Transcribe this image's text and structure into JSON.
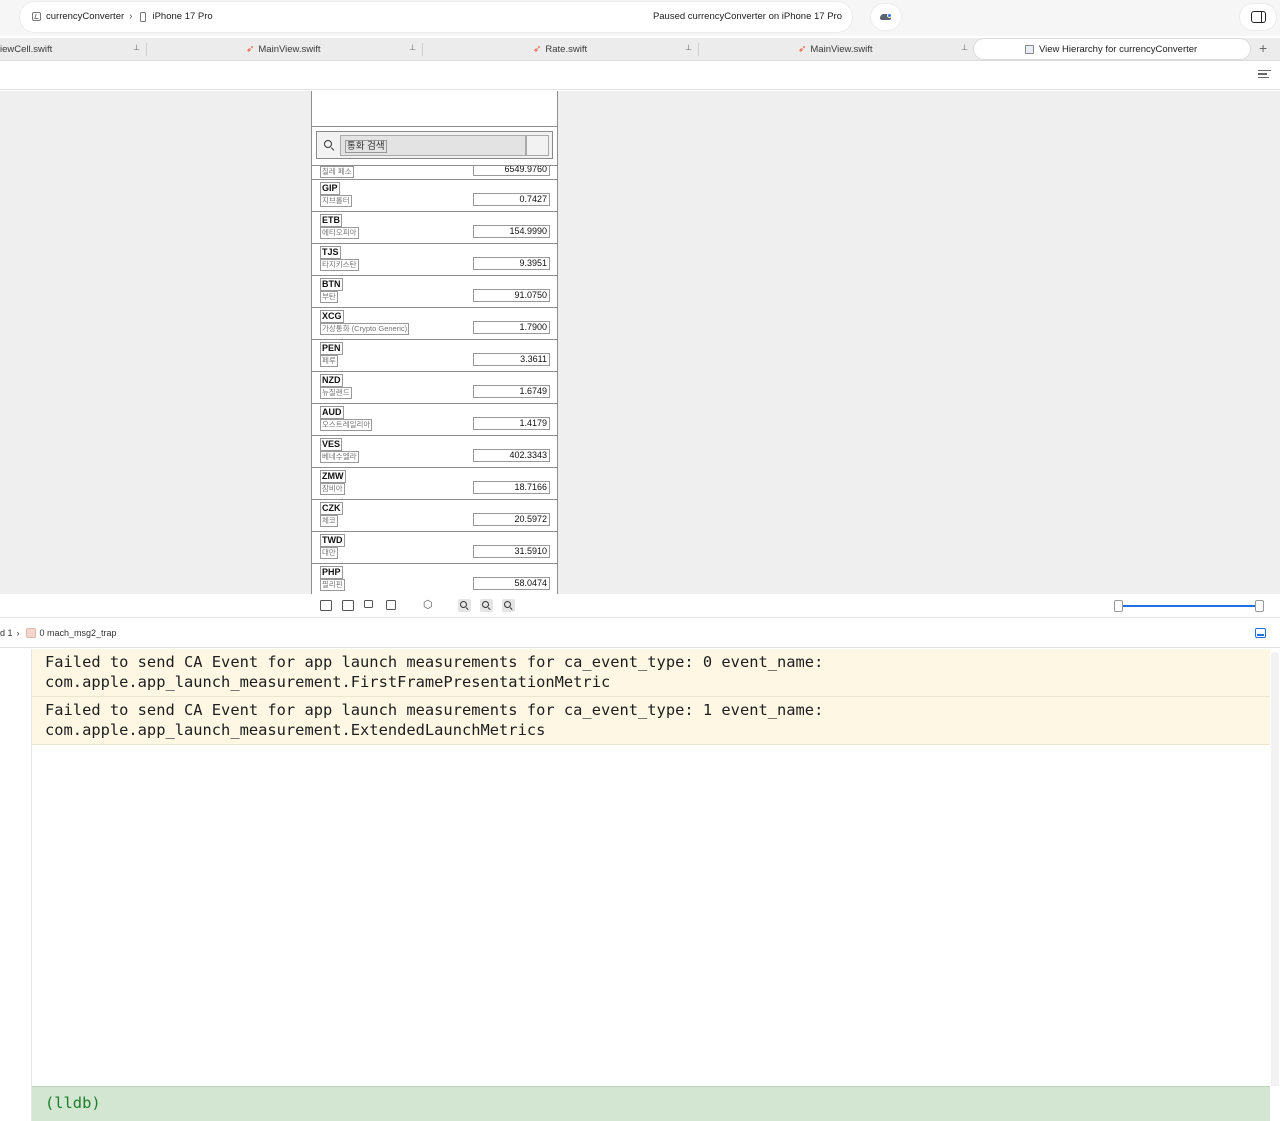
{
  "toolbar": {
    "scheme_app": "currencyConverter",
    "scheme_device": "iPhone 17 Pro",
    "status": "Paused currencyConverter on iPhone 17 Pro",
    "app_icon": "app-icon",
    "device_icon": "iphone-icon",
    "activity_icon": "cloud-status-icon",
    "inspector_icon": "sidebar-right-icon"
  },
  "tabs": [
    {
      "label": "iewCell.swift",
      "icon": "swift-icon"
    },
    {
      "label": "MainView.swift",
      "icon": "swift-icon"
    },
    {
      "label": "Rate.swift",
      "icon": "swift-icon"
    },
    {
      "label": "MainView.swift",
      "icon": "swift-icon"
    }
  ],
  "active_tab": {
    "label": "View Hierarchy for currencyConverter",
    "icon": "view-hierarchy-icon"
  },
  "tab_pin_icon": "pin-icon",
  "tab_add_icon": "plus-icon",
  "phone": {
    "search_placeholder": "통화 검색",
    "partial_row": {
      "code": "",
      "name": "칠레 페소",
      "rate": "6549.9760"
    },
    "rows": [
      {
        "code": "GIP",
        "name": "지브롤터",
        "rate": "0.7427"
      },
      {
        "code": "ETB",
        "name": "에티오피아",
        "rate": "154.9990"
      },
      {
        "code": "TJS",
        "name": "타지키스탄",
        "rate": "9.3951"
      },
      {
        "code": "BTN",
        "name": "부탄",
        "rate": "91.0750"
      },
      {
        "code": "XCG",
        "name": "가상통화 (Crypto Generic)",
        "rate": "1.7900"
      },
      {
        "code": "PEN",
        "name": "페루",
        "rate": "3.3611"
      },
      {
        "code": "NZD",
        "name": "뉴질랜드",
        "rate": "1.6749"
      },
      {
        "code": "AUD",
        "name": "오스트레일리아",
        "rate": "1.4179"
      },
      {
        "code": "VES",
        "name": "베네수엘라",
        "rate": "402.3343"
      },
      {
        "code": "ZMW",
        "name": "잠비아",
        "rate": "18.7166"
      },
      {
        "code": "CZK",
        "name": "체코",
        "rate": "20.5972"
      },
      {
        "code": "TWD",
        "name": "대만",
        "rate": "31.5910"
      },
      {
        "code": "PHP",
        "name": "필리핀",
        "rate": "58.0474"
      }
    ]
  },
  "canvas_controls": {
    "zoom_slider_value": 1.0
  },
  "debugbar": {
    "thread": "d 1",
    "frame": "0 mach_msg2_trap"
  },
  "console": {
    "messages": [
      "Failed to send CA Event for app launch measurements for ca_event_type: 0 event_name:\ncom.apple.app_launch_measurement.FirstFramePresentationMetric",
      "Failed to send CA Event for app launch measurements for ca_event_type: 1 event_name:\ncom.apple.app_launch_measurement.ExtendedLaunchMetrics"
    ],
    "prompt": "(lldb)"
  },
  "colors": {
    "accent": "#1f6fe5",
    "swift": "#f05138",
    "console_warning_bg": "#fdf7e3",
    "lldb_prompt_bg": "#d3e6d2",
    "lldb_prompt_text": "#1d7f2e"
  }
}
